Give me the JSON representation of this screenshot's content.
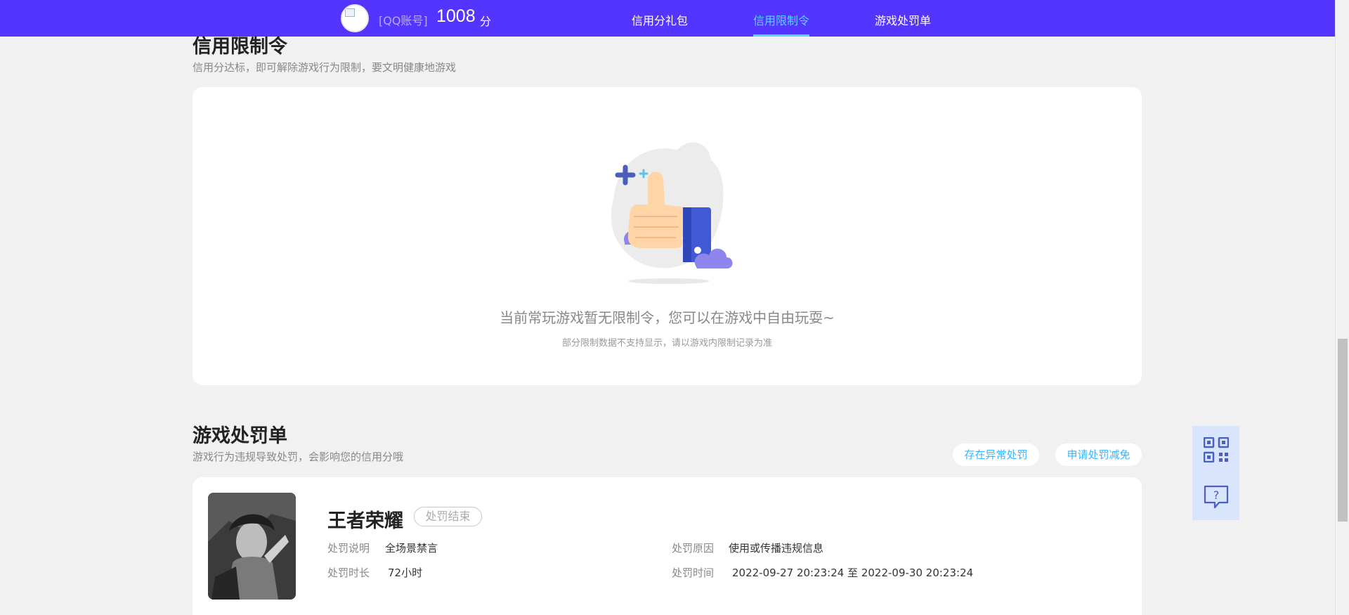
{
  "header": {
    "account_label": "[QQ账号]",
    "score": "1008",
    "score_unit": "分",
    "nav": [
      {
        "label": "信用分礼包",
        "active": false
      },
      {
        "label": "信用限制令",
        "active": true
      },
      {
        "label": "游戏处罚单",
        "active": false
      }
    ]
  },
  "restriction": {
    "title": "信用限制令",
    "subtitle": "信用分达标，即可解除游戏行为限制，要文明健康地游戏",
    "empty_text": "当前常玩游戏暂无限制令，您可以在游戏中自由玩耍~",
    "empty_note": "部分限制数据不支持显示，请以游戏内限制记录为准"
  },
  "penalty": {
    "title": "游戏处罚单",
    "subtitle": "游戏行为违规导致处罚，会影响您的信用分哦",
    "actions": [
      "存在异常处罚",
      "申请处罚减免"
    ],
    "record": {
      "game": "王者荣耀",
      "status": "处罚结束",
      "desc_label": "处罚说明",
      "desc_value": "全场景禁言",
      "duration_label": "处罚时长",
      "duration_value": "72小时",
      "reason_label": "处罚原因",
      "reason_value": "使用或传播违规信息",
      "time_label": "处罚时间",
      "time_value": "2022-09-27 20:23:24 至 2022-09-30 20:23:24"
    }
  },
  "floating": {
    "qr_icon": "qr-code-icon",
    "help_icon": "help-chat-icon"
  },
  "colors": {
    "nav_bg": "#5435ff",
    "nav_active": "#52d8ff",
    "link_blue": "#3ab3ff",
    "float_bg": "#d8e5fd"
  }
}
